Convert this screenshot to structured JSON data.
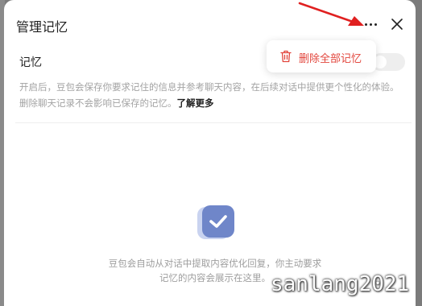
{
  "dialog": {
    "title": "管理记忆",
    "more_icon": "ellipsis-icon",
    "close_icon": "close-icon"
  },
  "memory": {
    "label": "记忆",
    "toggle_on": false,
    "description": "开启后，豆包会保存你要求记住的信息并参考聊天内容，在后续对话中提供更个性化的体验。删除聊天记录不会影响已保存的记忆。",
    "learn_more": "了解更多"
  },
  "menu": {
    "delete_all_label": "删除全部记忆",
    "delete_icon": "trash-icon",
    "accent_color": "#e2453c"
  },
  "empty_state": {
    "icon": "memory-check-icon",
    "line1": "豆包会自动从对话中提取内容优化回复，你主动要求",
    "line2": "记忆的内容会展示在这里。"
  },
  "watermark": "sanlang2021",
  "annotation": {
    "arrow_color": "#e02020"
  }
}
